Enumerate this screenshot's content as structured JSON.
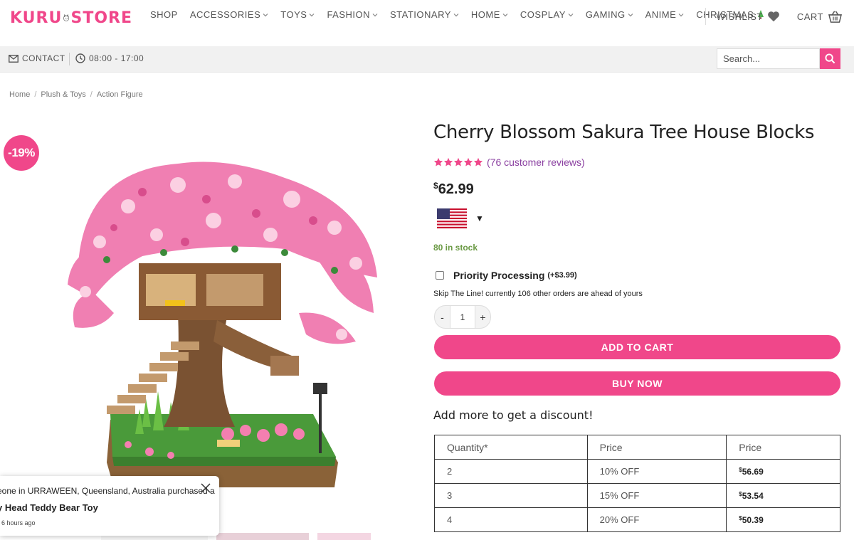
{
  "header": {
    "logo_left": "KURU",
    "logo_right": "STORE",
    "nav": [
      {
        "label": "SHOP",
        "dropdown": false
      },
      {
        "label": "ACCESSORIES",
        "dropdown": true
      },
      {
        "label": "TOYS",
        "dropdown": true
      },
      {
        "label": "FASHION",
        "dropdown": true
      },
      {
        "label": "STATIONARY",
        "dropdown": true
      },
      {
        "label": "HOME",
        "dropdown": true
      },
      {
        "label": "COSPLAY",
        "dropdown": true
      },
      {
        "label": "GAMING",
        "dropdown": true
      },
      {
        "label": "ANIME",
        "dropdown": true
      },
      {
        "label": "CHRISTMAS",
        "dropdown": false,
        "icon": "tree-icon"
      }
    ],
    "wishlist_label": "WISHLIST",
    "cart_label": "CART"
  },
  "topbar": {
    "contact_label": "CONTACT",
    "hours": "08:00 - 17:00",
    "search_placeholder": "Search..."
  },
  "breadcrumb": [
    "Home",
    "Plush & Toys",
    "Action Figure"
  ],
  "product": {
    "sale_badge": "-19%",
    "title": "Cherry Blossom Sakura Tree House Blocks",
    "rating": 5,
    "reviews": "(76 customer reviews)",
    "currency_symbol": "$",
    "price": "62.99",
    "currency_flag": "us-flag-icon",
    "stock": "80 in stock",
    "priority_label": "Priority Processing",
    "priority_extra": "(+$3.99)",
    "skip_text": "Skip The Line! currently 106 other orders are ahead of yours",
    "quantity": "1",
    "minus": "-",
    "plus": "+",
    "add_to_cart": "ADD TO CART",
    "buy_now": "BUY NOW"
  },
  "discount": {
    "title": "Add more to get a discount!",
    "headers": [
      "Quantity*",
      "Price",
      "Price"
    ],
    "rows": [
      {
        "qty": "2",
        "off": "10% OFF",
        "cur": "$",
        "price": "56.69"
      },
      {
        "qty": "3",
        "off": "15% OFF",
        "cur": "$",
        "price": "53.54"
      },
      {
        "qty": "4",
        "off": "20% OFF",
        "cur": "$",
        "price": "50.39"
      }
    ]
  },
  "popup": {
    "line1": "eone in URRAWEEN, Queensland, Australia purchased a",
    "line2": "y Head Teddy Bear Toy",
    "line3": "6 hours ago"
  },
  "colors": {
    "accent": "#f0478a",
    "stock_green": "#6b9a45",
    "reviews_purple": "#8a3fa0"
  }
}
